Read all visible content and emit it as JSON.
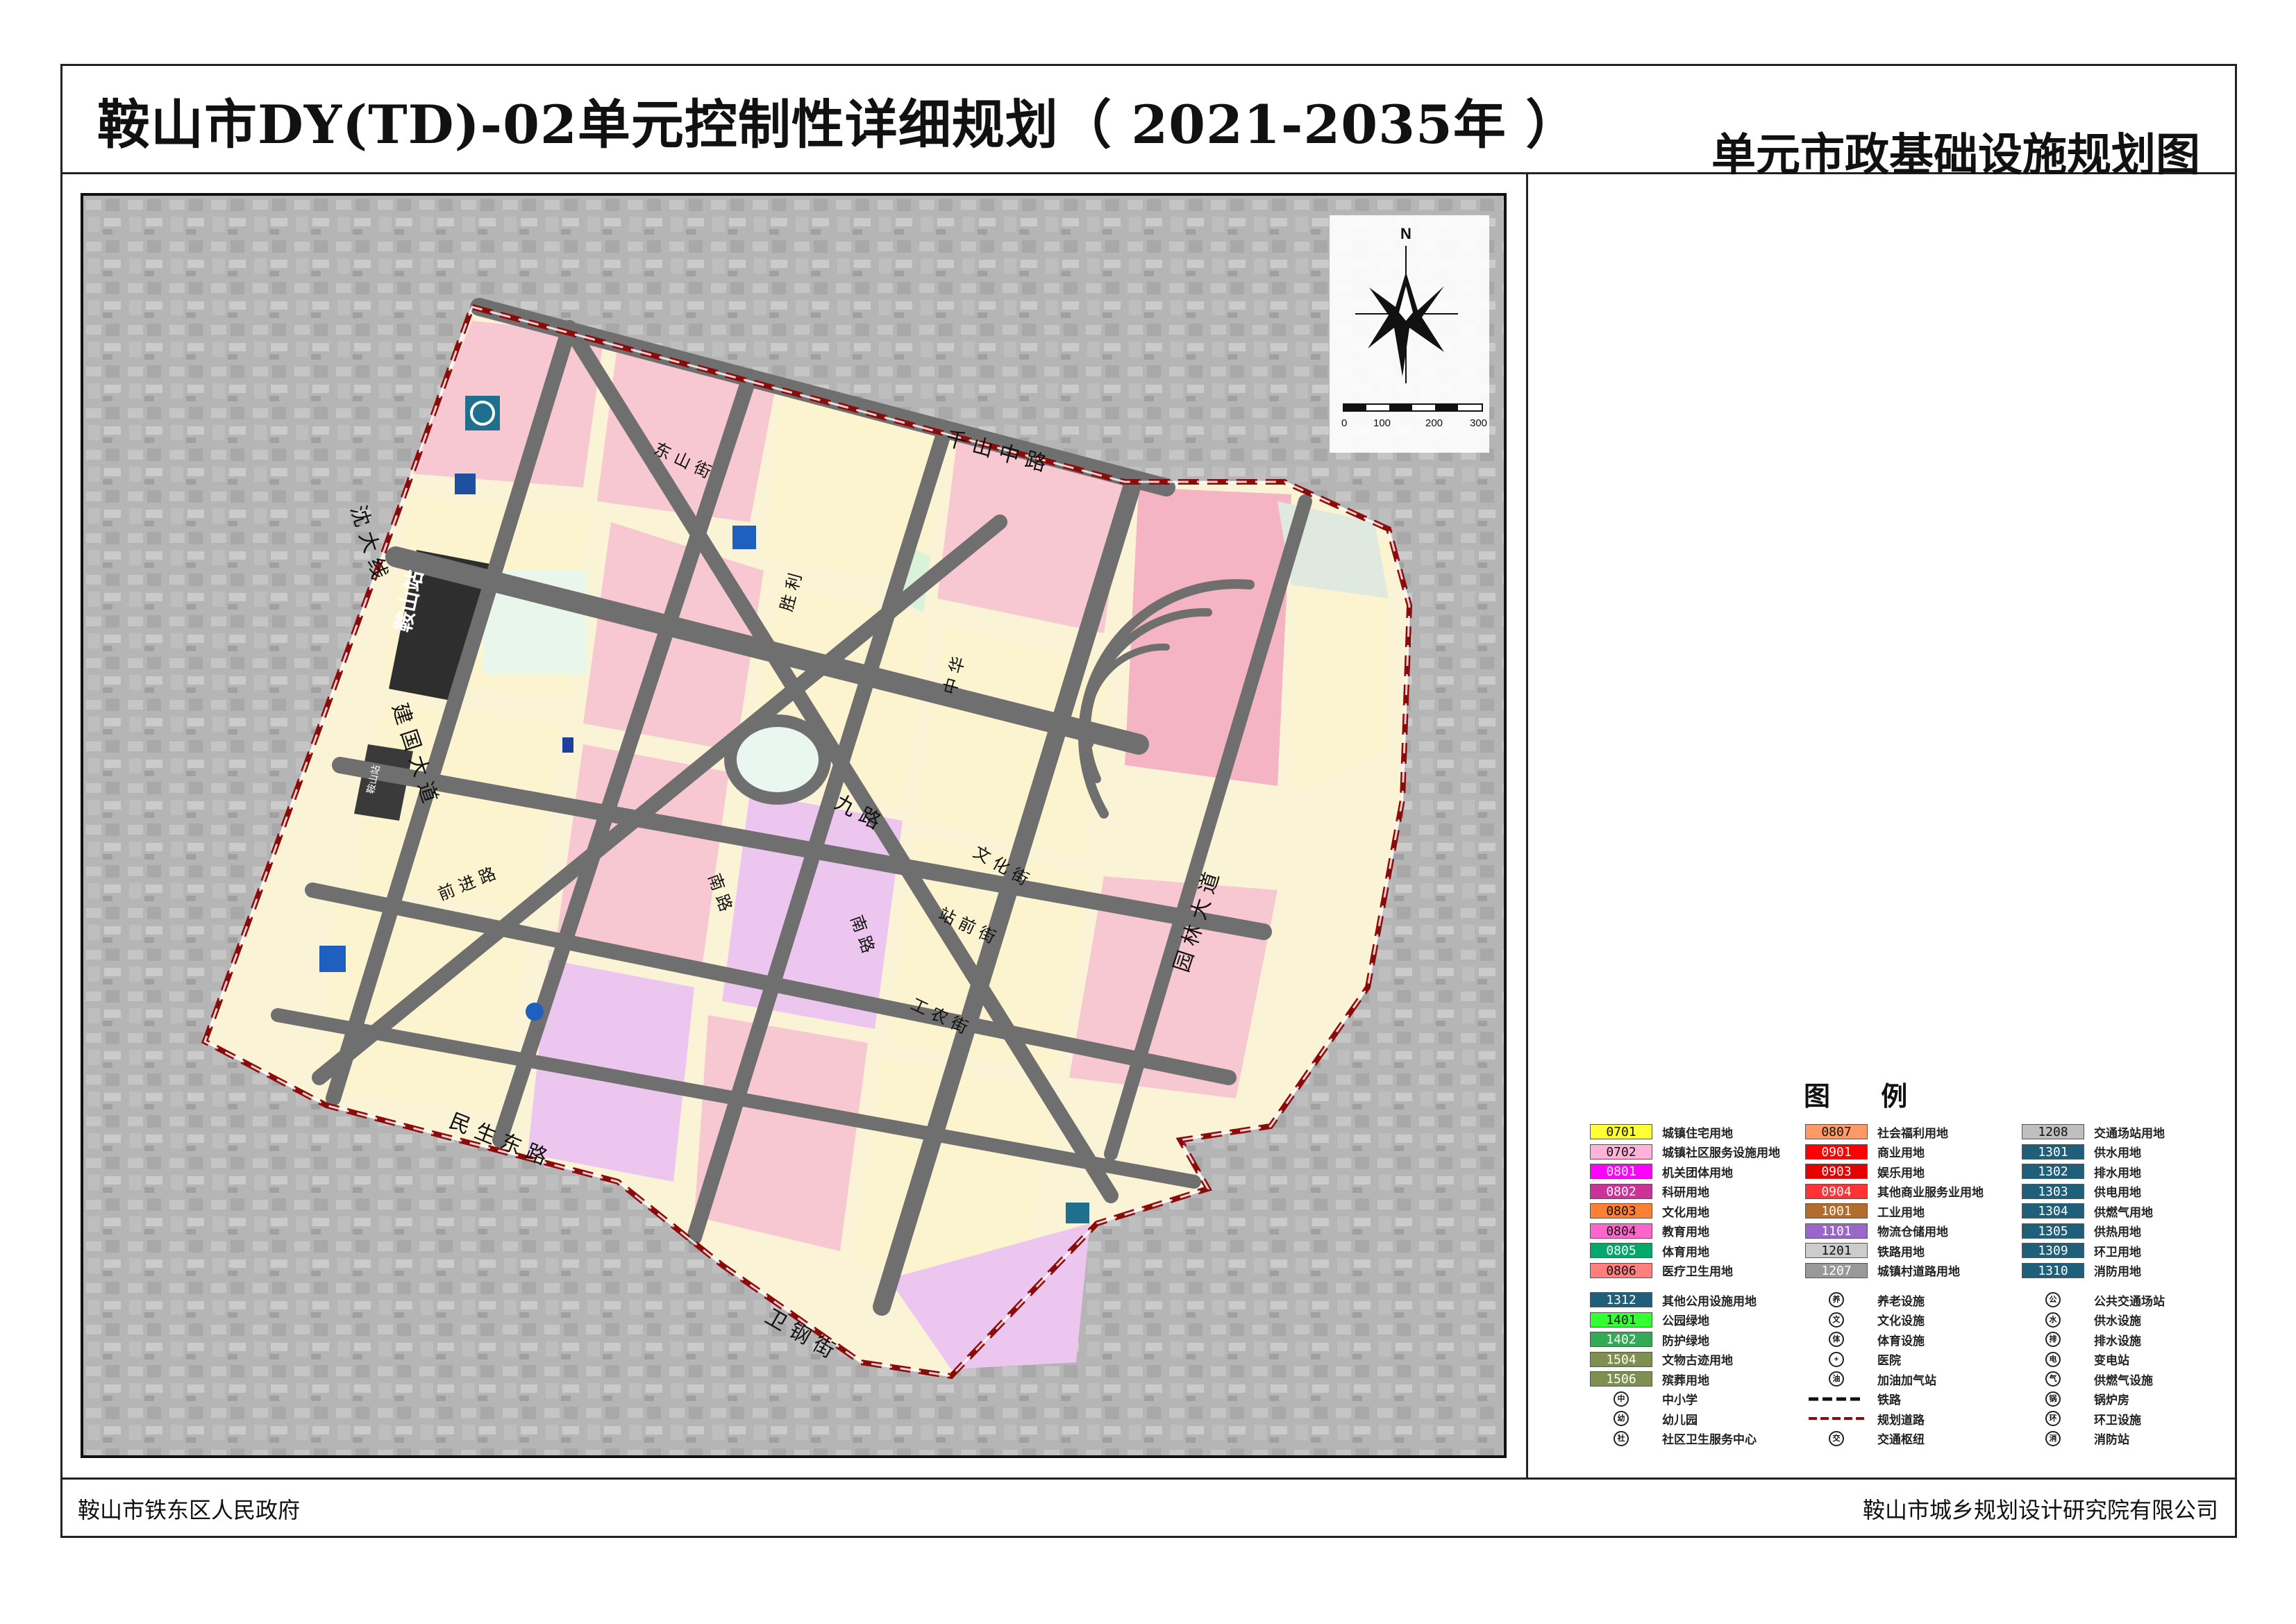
{
  "header": {
    "title": "鞍山市DY(TD)-02单元控制性详细规划（ 2021-2035年 ）",
    "subtitle": "单元市政基础设施规划图"
  },
  "footer": {
    "left": "鞍山市铁东区人民政府",
    "right": "鞍山市城乡规划设计研究院有限公司"
  },
  "map": {
    "north": "N",
    "scale_ticks": [
      "0",
      "100",
      "200",
      "300"
    ],
    "roads": {
      "qianshan": "千 山 中 路",
      "shenda": "沈 大 线",
      "jianguo": "建 国 大 道",
      "minsheng": "民 生 东 路",
      "weigang": "卫 钢 街",
      "yuanlin": "园 林 大 道",
      "dongshan": "东 山 街",
      "jiulu": "九 路",
      "wenhua": "文 化 街",
      "zhanqian": "站 前 街",
      "gongnong": "工 农 街",
      "shengli": "胜 利",
      "zhonghua": "中 华",
      "nanlu": "南 路",
      "xiangyang": "前 进 路",
      "xinnan": "南 路"
    },
    "station": "鞍山站",
    "station2": "鞍山站"
  },
  "legend": {
    "title": "图  例",
    "col1": [
      {
        "code": "0701",
        "label": "城镇住宅用地",
        "color": "#ffff33"
      },
      {
        "code": "0702",
        "label": "城镇社区服务设施用地",
        "color": "#ffb3d9"
      },
      {
        "code": "0801",
        "label": "机关团体用地",
        "color": "#ff00ff"
      },
      {
        "code": "0802",
        "label": "科研用地",
        "color": "#cc3399"
      },
      {
        "code": "0803",
        "label": "文化用地",
        "color": "#ff8033"
      },
      {
        "code": "0804",
        "label": "教育用地",
        "color": "#ff66cc"
      },
      {
        "code": "0805",
        "label": "体育用地",
        "color": "#00a86b"
      },
      {
        "code": "0806",
        "label": "医疗卫生用地",
        "color": "#ff7f7f"
      }
    ],
    "col2": [
      {
        "code": "0807",
        "label": "社会福利用地",
        "color": "#ff9966"
      },
      {
        "code": "0901",
        "label": "商业用地",
        "color": "#ff0000"
      },
      {
        "code": "0903",
        "label": "娱乐用地",
        "color": "#e60000"
      },
      {
        "code": "0904",
        "label": "其他商业服务业用地",
        "color": "#ff3333"
      },
      {
        "code": "1001",
        "label": "工业用地",
        "color": "#b36b2e"
      },
      {
        "code": "1101",
        "label": "物流仓储用地",
        "color": "#9966cc"
      },
      {
        "code": "1201",
        "label": "铁路用地",
        "color": "#cccccc"
      },
      {
        "code": "1207",
        "label": "城镇村道路用地",
        "color": "#999999"
      }
    ],
    "col3": [
      {
        "code": "1208",
        "label": "交通场站用地",
        "color": "#bfbfbf"
      },
      {
        "code": "1301",
        "label": "供水用地",
        "color": "#1f5f7a"
      },
      {
        "code": "1302",
        "label": "排水用地",
        "color": "#1f5f7a"
      },
      {
        "code": "1303",
        "label": "供电用地",
        "color": "#1f5f7a"
      },
      {
        "code": "1304",
        "label": "供燃气用地",
        "color": "#1f5f7a"
      },
      {
        "code": "1305",
        "label": "供热用地",
        "color": "#1f5f7a"
      },
      {
        "code": "1309",
        "label": "环卫用地",
        "color": "#1f5f7a"
      },
      {
        "code": "1310",
        "label": "消防用地",
        "color": "#1f5f7a"
      }
    ],
    "col1b": [
      {
        "code": "1312",
        "label": "其他公用设施用地",
        "color": "#1f5f7a"
      },
      {
        "code": "1401",
        "label": "公园绿地",
        "color": "#33ff33"
      },
      {
        "code": "1402",
        "label": "防护绿地",
        "color": "#33aa55"
      },
      {
        "code": "1504",
        "label": "文物古迹用地",
        "color": "#7f8f4f"
      },
      {
        "code": "1506",
        "label": "殡葬用地",
        "color": "#7f8f4f"
      }
    ],
    "col1sym": [
      {
        "sym": "中",
        "label": "中小学"
      },
      {
        "sym": "幼",
        "label": "幼儿园"
      },
      {
        "sym": "社",
        "label": "社区卫生服务中心"
      }
    ],
    "col2sym": [
      {
        "sym": "养",
        "label": "养老设施"
      },
      {
        "sym": "文",
        "label": "文化设施"
      },
      {
        "sym": "体",
        "label": "体育设施"
      },
      {
        "sym": "+",
        "label": "医院"
      },
      {
        "sym": "油",
        "label": "加油加气站"
      },
      {
        "sym": "rail",
        "label": "铁路"
      },
      {
        "sym": "dash",
        "label": "规划道路"
      },
      {
        "sym": "交",
        "label": "交通枢纽"
      }
    ],
    "col3sym": [
      {
        "sym": "公",
        "label": "公共交通场站"
      },
      {
        "sym": "水",
        "label": "供水设施"
      },
      {
        "sym": "排",
        "label": "排水设施"
      },
      {
        "sym": "电",
        "label": "变电站"
      },
      {
        "sym": "气",
        "label": "供燃气设施"
      },
      {
        "sym": "锅",
        "label": "锅炉房"
      },
      {
        "sym": "环",
        "label": "环卫设施"
      },
      {
        "sym": "消",
        "label": "消防站"
      }
    ]
  }
}
